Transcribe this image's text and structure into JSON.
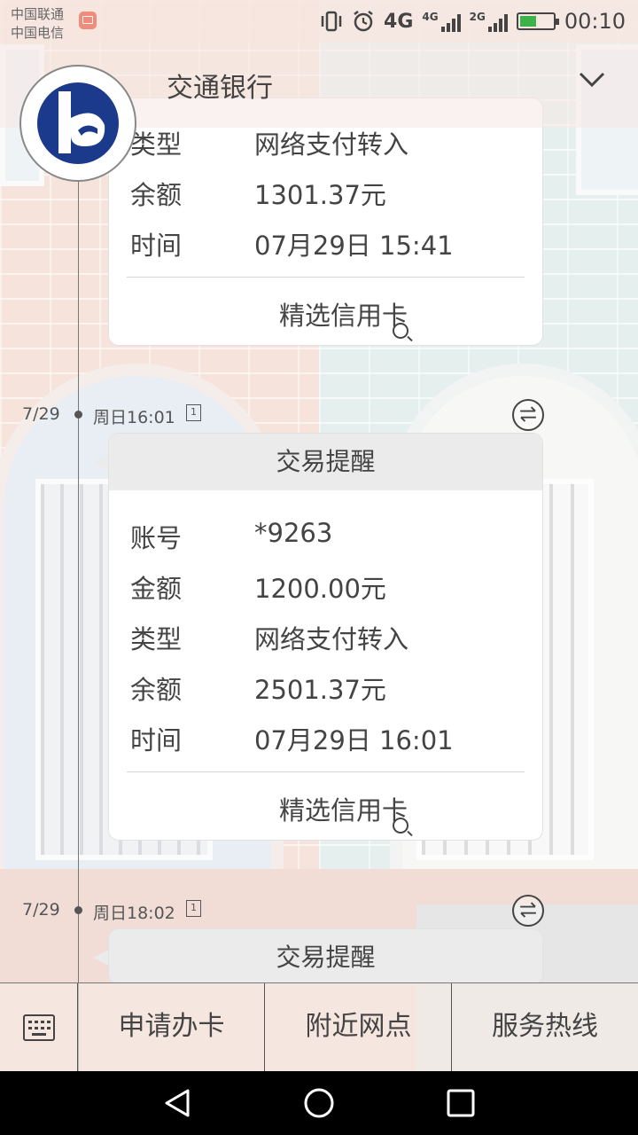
{
  "status_bar": {
    "carrier_1": "中国联通",
    "carrier_2": "中国电信",
    "network_1": "4G",
    "network_2": "4G",
    "network_3": "2G",
    "time": "00:10",
    "icons": [
      "mail-icon",
      "vibrate-icon",
      "alarm-icon",
      "signal-icon",
      "battery-charging-icon"
    ]
  },
  "header": {
    "title": "交通银行"
  },
  "card_top": {
    "rows": [
      {
        "key": "类型",
        "value": "网络支付转入"
      },
      {
        "key": "余额",
        "value": "1301.37元"
      },
      {
        "key": "时间",
        "value": "07月29日 15:41"
      }
    ],
    "footer_link": "精选信用卡"
  },
  "entry_1": {
    "date": "7/29",
    "time": "周日16:01",
    "note_icon": "1",
    "card_title": "交易提醒",
    "rows": [
      {
        "key": "账号",
        "value": "*9263"
      },
      {
        "key": "金额",
        "value": "1200.00元"
      },
      {
        "key": "类型",
        "value": "网络支付转入"
      },
      {
        "key": "余额",
        "value": "2501.37元"
      },
      {
        "key": "时间",
        "value": "07月29日 16:01"
      }
    ],
    "footer_link": "精选信用卡"
  },
  "entry_2": {
    "date": "7/29",
    "time": "周日18:02",
    "note_icon": "1",
    "card_title": "交易提醒"
  },
  "bottom_nav": {
    "apply_card": "申请办卡",
    "nearby_branches": "附近网点",
    "service_hotline": "服务热线"
  }
}
